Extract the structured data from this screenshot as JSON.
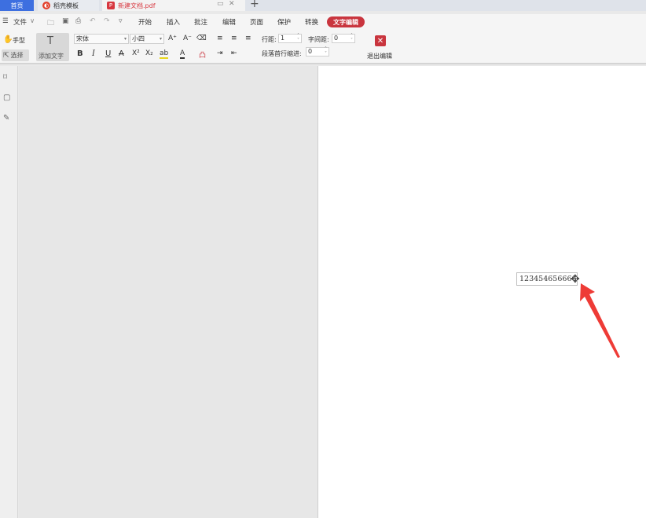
{
  "tabs": {
    "home": "首页",
    "template": "稻壳模板",
    "document": "新建文档.pdf",
    "add": "+"
  },
  "menu": {
    "hamburger": "☰",
    "file": "文件",
    "file_caret": "∨",
    "items": [
      "开始",
      "插入",
      "批注",
      "编辑",
      "页面",
      "保护",
      "转换"
    ],
    "active": "文字编辑"
  },
  "ribbon": {
    "hand": "手型",
    "select": "选择",
    "add_text": "添加文字",
    "font_name": "宋体",
    "font_size": "小四",
    "line_spacing_label": "行距:",
    "line_spacing_value": "1",
    "char_spacing_label": "字间距:",
    "char_spacing_value": "0",
    "indent_label": "段落首行缩进:",
    "indent_value": "0",
    "exit_edit": "退出编辑",
    "grow_font": "A⁺",
    "shrink_font": "A⁻",
    "bold": "B",
    "italic": "I",
    "underline": "U",
    "strikethrough": "A",
    "superscript": "X²",
    "subscript": "X₂",
    "highlight": "ab",
    "font_color": "A",
    "eraser": "⌫",
    "fill": "凸"
  },
  "page": {
    "textbox_content": "1234546566666"
  },
  "colors": {
    "accent_red": "#c9353e",
    "home_tab_blue": "#3d6fe0",
    "annotation_arrow": "#ee3b36"
  }
}
